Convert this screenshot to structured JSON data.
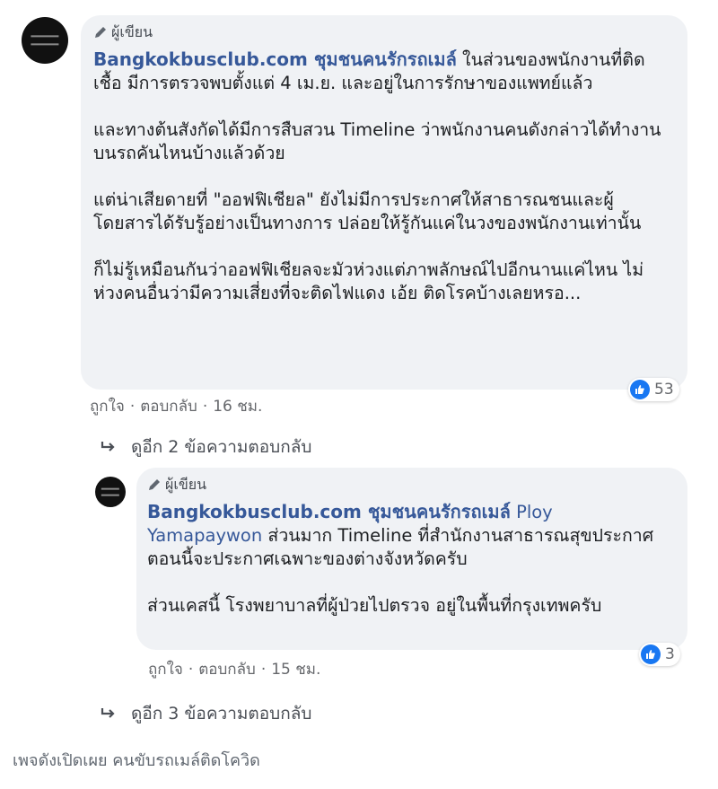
{
  "comment1": {
    "author_badge": "ผู้เขียน",
    "author_name": "Bangkokbusclub.com ชุมชนคนรักรถเมล์",
    "text_head": " ในส่วนของพนักงานที่ติดเชื้อ มีการตรวจพบตั้งแต่ 4 เม.ย. และอยู่ในการรักษาของแพทย์แล้ว",
    "para2": "และทางต้นสังกัดได้มีการสืบสวน Timeline ว่าพนักงานคนดังกล่าวได้ทำงานบนรถคันไหนบ้างแล้วด้วย",
    "para3": "แต่น่าเสียดายที่ \"ออฟฟิเชียล\" ยังไม่มีการประกาศให้สาธารณชนและผู้โดยสารได้รับรู้อย่างเป็นทางการ ปล่อยให้รู้กันแค่ในวงของพนักงานเท่านั้น",
    "para4": "ก็ไม่รู้เหมือนกันว่าออฟฟิเชียลจะมัวห่วงแต่ภาพลักษณ์ไปอีกนานแค่ไหน ไม่ห่วงคนอื่นว่ามีความเสี่ยงที่จะติดไฟแดง เอ้ย ติดโรคบ้างเลยหรอ...",
    "like_label": "ถูกใจ",
    "reply_label": "ตอบกลับ",
    "time": "16 ชม.",
    "reaction_count": "53",
    "more_replies": "ดูอีก 2 ข้อความตอบกลับ"
  },
  "comment2": {
    "author_badge": "ผู้เขียน",
    "author_name": "Bangkokbusclub.com ชุมชนคนรักรถเมล์",
    "mention": "Ploy Yamapaywon",
    "text_head": " ส่วนมาก Timeline ที่สำนักงานสาธารณสุขประกาศ ตอนนี้จะประกาศเฉพาะของต่างจังหวัดครับ",
    "para2": "ส่วนเคสนี้ โรงพยาบาลที่ผู้ป่วยไปตรวจ อยู่ในพื้นที่กรุงเทพครับ",
    "like_label": "ถูกใจ",
    "reply_label": "ตอบกลับ",
    "time": "15 ชม.",
    "reaction_count": "3",
    "more_replies": "ดูอีก 3 ข้อความตอบกลับ"
  },
  "caption": "เพจดังเปิดเผย คนขับรถเมล์ติดโควิด",
  "colors": {
    "link": "#365899",
    "bubble": "#f0f2f5",
    "like_blue": "#1877f2"
  },
  "icons": [
    "pencil-icon",
    "reply-arrow-icon",
    "like-reaction-icon"
  ]
}
